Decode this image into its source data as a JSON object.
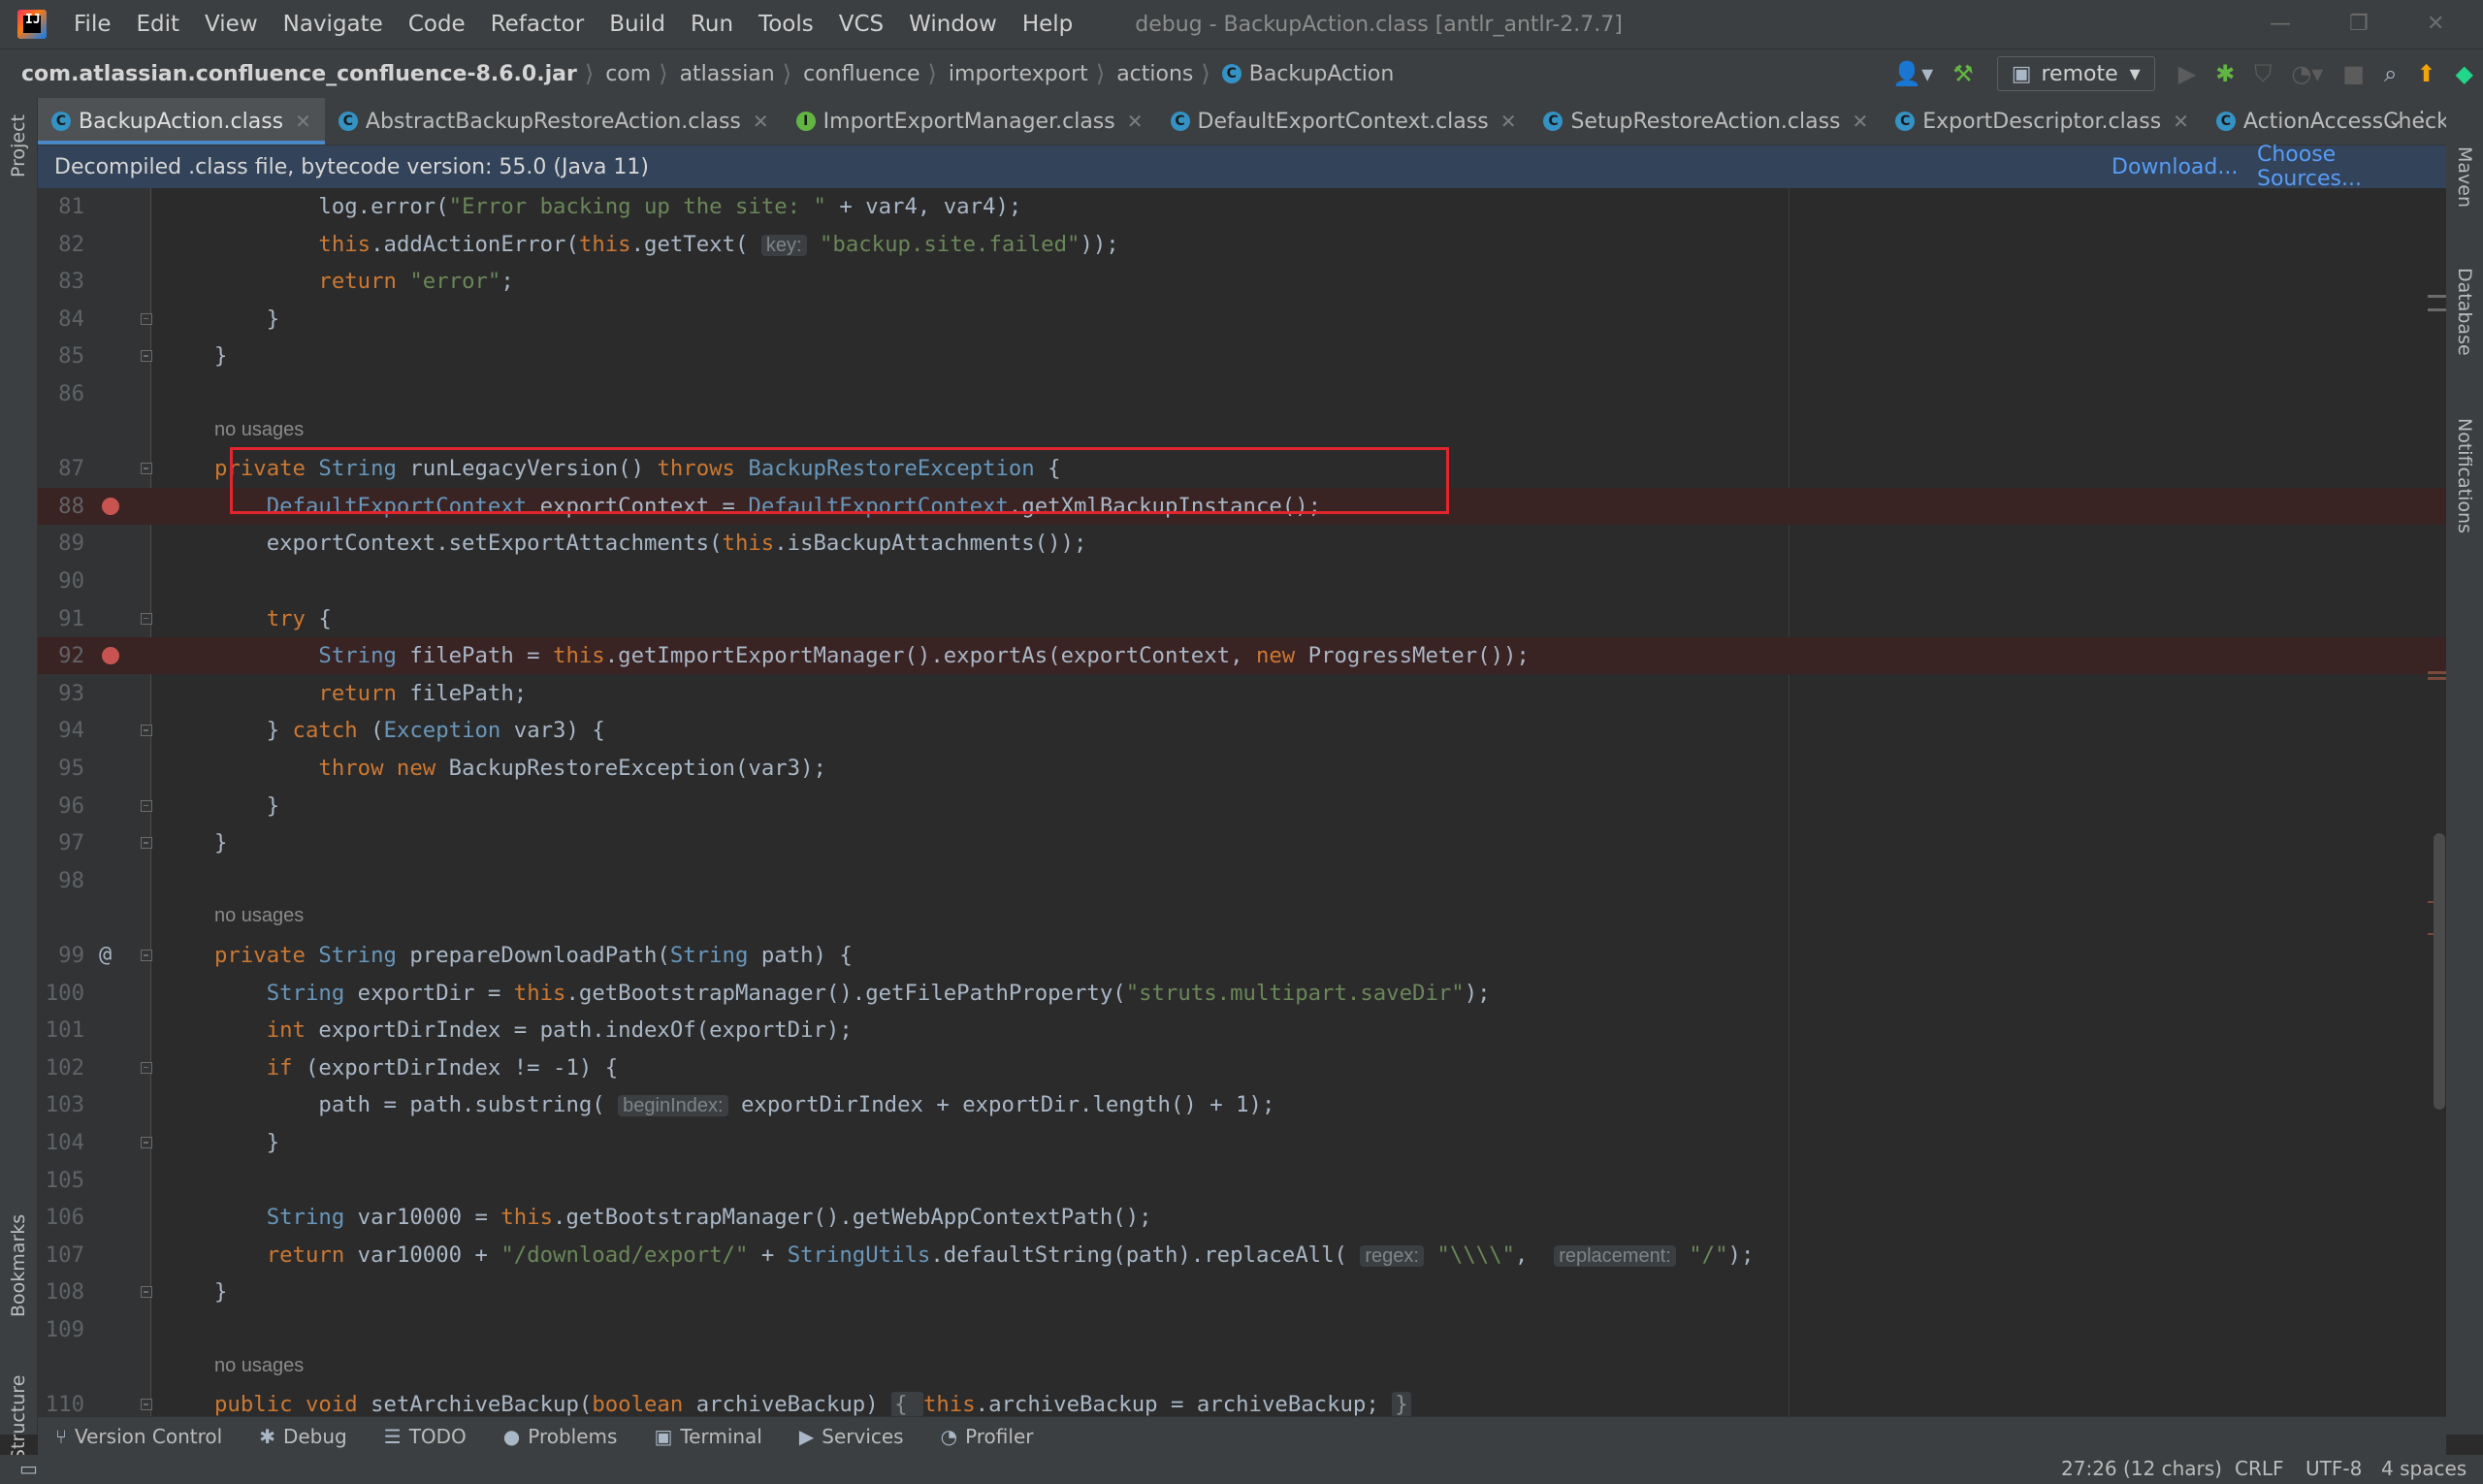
{
  "menu": {
    "items": [
      "File",
      "Edit",
      "View",
      "Navigate",
      "Code",
      "Refactor",
      "Build",
      "Run",
      "Tools",
      "VCS",
      "Window",
      "Help"
    ],
    "window_title": "debug - BackupAction.class [antlr_antlr-2.7.7]"
  },
  "breadcrumb": [
    "com.atlassian.confluence_confluence-8.6.0.jar",
    "com",
    "atlassian",
    "confluence",
    "importexport",
    "actions",
    "BackupAction"
  ],
  "toolbar": {
    "run_config": "remote"
  },
  "tabs": [
    {
      "label": "BackupAction.class",
      "icon": "class-icon",
      "active": true
    },
    {
      "label": "AbstractBackupRestoreAction.class",
      "icon": "class-icon"
    },
    {
      "label": "ImportExportManager.class",
      "icon": "interface-icon"
    },
    {
      "label": "DefaultExportContext.class",
      "icon": "class-icon"
    },
    {
      "label": "SetupRestoreAction.class",
      "icon": "class-icon"
    },
    {
      "label": "ExportDescriptor.class",
      "icon": "class-icon"
    },
    {
      "label": "ActionAccessChecker.c",
      "icon": "class-icon"
    }
  ],
  "banner": {
    "message": "Decompiled .class file, bytecode version: 55.0 (Java 11)",
    "download": "Download...",
    "choose_sources": "Choose Sources..."
  },
  "hints": {
    "key": "key:",
    "beginIndex": "beginIndex:",
    "regex": "regex:",
    "replacement": "replacement:"
  },
  "code": {
    "no_usages": "no usages",
    "lines": [
      {
        "n": "81",
        "segs": [
          [
            "t",
            "            log.error("
          ],
          [
            "s",
            "\"Error backing up the site: \""
          ],
          [
            "t",
            " + var4, var4);"
          ]
        ]
      },
      {
        "n": "82",
        "segs": [
          [
            "t",
            "            "
          ],
          [
            "k",
            "this"
          ],
          [
            "t",
            ".addActionError("
          ],
          [
            "k",
            "this"
          ],
          [
            "t",
            ".getText( "
          ],
          [
            "hint",
            "key:"
          ],
          [
            "s",
            " \"backup.site.failed\""
          ],
          [
            "t",
            "));"
          ]
        ]
      },
      {
        "n": "83",
        "segs": [
          [
            "t",
            "            "
          ],
          [
            "k",
            "return "
          ],
          [
            "s",
            "\"error\""
          ],
          [
            "t",
            ";"
          ]
        ]
      },
      {
        "n": "84",
        "segs": [
          [
            "t",
            "        }"
          ]
        ]
      },
      {
        "n": "85",
        "segs": [
          [
            "t",
            "    }"
          ]
        ]
      },
      {
        "n": "86",
        "segs": []
      },
      {
        "n": "87",
        "segs": [
          [
            "k",
            "    private "
          ],
          [
            "ty",
            "String "
          ],
          [
            "t",
            "runLegacyVersion() "
          ],
          [
            "k",
            "throws "
          ],
          [
            "ty",
            "BackupRestoreException "
          ],
          [
            "t",
            "{"
          ]
        ]
      },
      {
        "n": "88",
        "segs": [
          [
            "ty",
            "        DefaultExportContext "
          ],
          [
            "t",
            "exportContext = "
          ],
          [
            "ty",
            "DefaultExportContext"
          ],
          [
            "t",
            ".getXmlBackupInstance();"
          ]
        ]
      },
      {
        "n": "89",
        "segs": [
          [
            "t",
            "        exportContext.setExportAttachments("
          ],
          [
            "k",
            "this"
          ],
          [
            "t",
            ".isBackupAttachments());"
          ]
        ]
      },
      {
        "n": "90",
        "segs": []
      },
      {
        "n": "91",
        "segs": [
          [
            "k",
            "        try "
          ],
          [
            "t",
            "{"
          ]
        ]
      },
      {
        "n": "92",
        "segs": [
          [
            "ty",
            "            String "
          ],
          [
            "t",
            "filePath = "
          ],
          [
            "k",
            "this"
          ],
          [
            "t",
            ".getImportExportManager().exportAs(exportContext, "
          ],
          [
            "k",
            "new "
          ],
          [
            "t",
            "ProgressMeter());"
          ]
        ]
      },
      {
        "n": "93",
        "segs": [
          [
            "k",
            "            return "
          ],
          [
            "t",
            "filePath;"
          ]
        ]
      },
      {
        "n": "94",
        "segs": [
          [
            "t",
            "        } "
          ],
          [
            "k",
            "catch "
          ],
          [
            "t",
            "("
          ],
          [
            "ty",
            "Exception "
          ],
          [
            "t",
            "var3) {"
          ]
        ]
      },
      {
        "n": "95",
        "segs": [
          [
            "k",
            "            throw new "
          ],
          [
            "t",
            "BackupRestoreException(var3);"
          ]
        ]
      },
      {
        "n": "96",
        "segs": [
          [
            "t",
            "        }"
          ]
        ]
      },
      {
        "n": "97",
        "segs": [
          [
            "t",
            "    }"
          ]
        ]
      },
      {
        "n": "98",
        "segs": []
      },
      {
        "n": "99",
        "segs": [
          [
            "k",
            "    private "
          ],
          [
            "ty",
            "String "
          ],
          [
            "t",
            "prepareDownloadPath("
          ],
          [
            "ty",
            "String "
          ],
          [
            "t",
            "path) {"
          ]
        ]
      },
      {
        "n": "100",
        "segs": [
          [
            "ty",
            "        String "
          ],
          [
            "t",
            "exportDir = "
          ],
          [
            "k",
            "this"
          ],
          [
            "t",
            ".getBootstrapManager().getFilePathProperty("
          ],
          [
            "s",
            "\"struts.multipart.saveDir\""
          ],
          [
            "t",
            ");"
          ]
        ]
      },
      {
        "n": "101",
        "segs": [
          [
            "k",
            "        int "
          ],
          [
            "t",
            "exportDirIndex = path.indexOf(exportDir);"
          ]
        ]
      },
      {
        "n": "102",
        "segs": [
          [
            "k",
            "        if "
          ],
          [
            "t",
            "(exportDirIndex != -1) {"
          ]
        ]
      },
      {
        "n": "103",
        "segs": [
          [
            "t",
            "            path = path.substring( "
          ],
          [
            "hint",
            "beginIndex:"
          ],
          [
            "t",
            " exportDirIndex + exportDir.length() + 1);"
          ]
        ]
      },
      {
        "n": "104",
        "segs": [
          [
            "t",
            "        }"
          ]
        ]
      },
      {
        "n": "105",
        "segs": []
      },
      {
        "n": "106",
        "segs": [
          [
            "ty",
            "        String "
          ],
          [
            "t",
            "var10000 = "
          ],
          [
            "k",
            "this"
          ],
          [
            "t",
            ".getBootstrapManager().getWebAppContextPath();"
          ]
        ]
      },
      {
        "n": "107",
        "segs": [
          [
            "k",
            "        return "
          ],
          [
            "t",
            "var10000 + "
          ],
          [
            "s",
            "\"/download/export/\""
          ],
          [
            "t",
            " + "
          ],
          [
            "ty",
            "StringUtils"
          ],
          [
            "t",
            ".defaultString(path).replaceAll( "
          ],
          [
            "hint",
            "regex:"
          ],
          [
            "s",
            " \"\\\\\\\\\""
          ],
          [
            "t",
            ",  "
          ],
          [
            "hint",
            "replacement:"
          ],
          [
            "s",
            " \"/\""
          ],
          [
            "t",
            ");"
          ]
        ]
      },
      {
        "n": "108",
        "segs": [
          [
            "t",
            "    }"
          ]
        ]
      },
      {
        "n": "109",
        "segs": []
      },
      {
        "n": "110",
        "segs": [
          [
            "k",
            "    public void "
          ],
          [
            "t",
            "setArchiveBackup("
          ],
          [
            "k",
            "boolean "
          ],
          [
            "t",
            "archiveBackup) "
          ],
          [
            "brace",
            "{ "
          ],
          [
            "k",
            "this"
          ],
          [
            "t",
            ".archiveBackup = archiveBackup; "
          ],
          [
            "brace",
            "}"
          ]
        ]
      }
    ]
  },
  "left_strip": {
    "project": "Project",
    "bookmarks": "Bookmarks",
    "structure": "Structure"
  },
  "right_strip": {
    "maven": "Maven",
    "database": "Database",
    "notifications": "Notifications"
  },
  "bottom_tools": [
    "Version Control",
    "Debug",
    "TODO",
    "Problems",
    "Terminal",
    "Services",
    "Profiler"
  ],
  "status": {
    "position": "27:26 (12 chars)",
    "line_sep": "CRLF",
    "encoding": "UTF-8",
    "indent": "4 spaces"
  },
  "colors": {
    "keyword": "#cc7832",
    "string": "#6a8759",
    "type": "#6897bb",
    "breakpoint": "#c75450",
    "highlight_box": "#e3252d"
  }
}
